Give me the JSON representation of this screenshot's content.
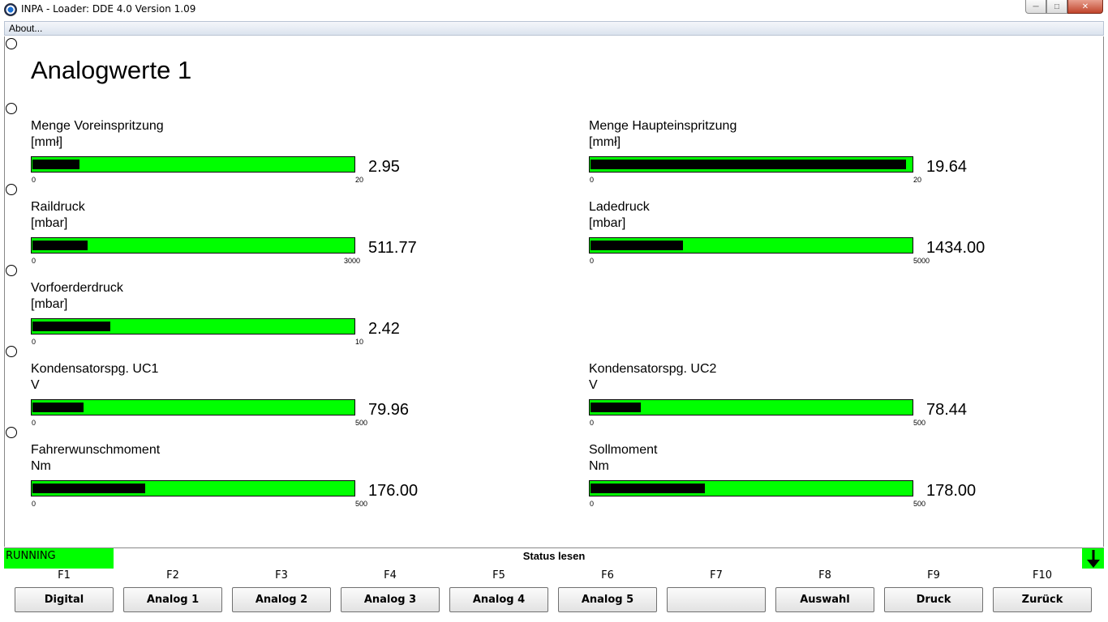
{
  "window": {
    "title": "INPA - Loader:  DDE 4.0 Version 1.09",
    "minimize": "─",
    "maximize": "□",
    "close": "✕"
  },
  "menu": {
    "about": "About..."
  },
  "page": {
    "title": "Analogwerte 1"
  },
  "gauges": [
    {
      "label": "Menge Voreinspritzung",
      "unit": "[mmł]",
      "value": "2.95",
      "min": "0",
      "max": "20",
      "fraction": 0.1475
    },
    {
      "label": "Menge Haupteinspritzung",
      "unit": "[mmł]",
      "value": "19.64",
      "min": "0",
      "max": "20",
      "fraction": 0.982
    },
    {
      "label": "Raildruck",
      "unit": "[mbar]",
      "value": "511.77",
      "min": "0",
      "max": "3000",
      "fraction": 0.1706
    },
    {
      "label": "Ladedruck",
      "unit": "[mbar]",
      "value": "1434.00",
      "min": "0",
      "max": "5000",
      "fraction": 0.2868
    },
    {
      "label": "Vorfoerderdruck",
      "unit": "[mbar]",
      "value": "2.42",
      "min": "0",
      "max": "10",
      "fraction": 0.242
    },
    {
      "label": "Kondensatorspg. UC1",
      "unit": "V",
      "value": "79.96",
      "min": "0",
      "max": "500",
      "fraction": 0.1599
    },
    {
      "label": "Kondensatorspg. UC2",
      "unit": "V",
      "value": "78.44",
      "min": "0",
      "max": "500",
      "fraction": 0.1569
    },
    {
      "label": "Fahrerwunschmoment",
      "unit": "Nm",
      "value": "176.00",
      "min": "0",
      "max": "500",
      "fraction": 0.352
    },
    {
      "label": "Sollmoment",
      "unit": "Nm",
      "value": "178.00",
      "min": "0",
      "max": "500",
      "fraction": 0.356
    }
  ],
  "status": {
    "state": "RUNNING",
    "text": "Status lesen",
    "state_color": "#00ff00"
  },
  "fkeys": [
    {
      "key": "F1",
      "label": "Digital"
    },
    {
      "key": "F2",
      "label": "Analog 1"
    },
    {
      "key": "F3",
      "label": "Analog 2"
    },
    {
      "key": "F4",
      "label": "Analog 3"
    },
    {
      "key": "F5",
      "label": "Analog 4"
    },
    {
      "key": "F6",
      "label": "Analog 5"
    },
    {
      "key": "F7",
      "label": ""
    },
    {
      "key": "F8",
      "label": "Auswahl"
    },
    {
      "key": "F9",
      "label": "Druck"
    },
    {
      "key": "F10",
      "label": "Zurück"
    }
  ],
  "colors": {
    "gauge_bg": "#00ff00",
    "gauge_fill": "#000000"
  },
  "icons": {
    "app": "bmw-logo-icon",
    "scroll": "down-arrow-icon"
  }
}
